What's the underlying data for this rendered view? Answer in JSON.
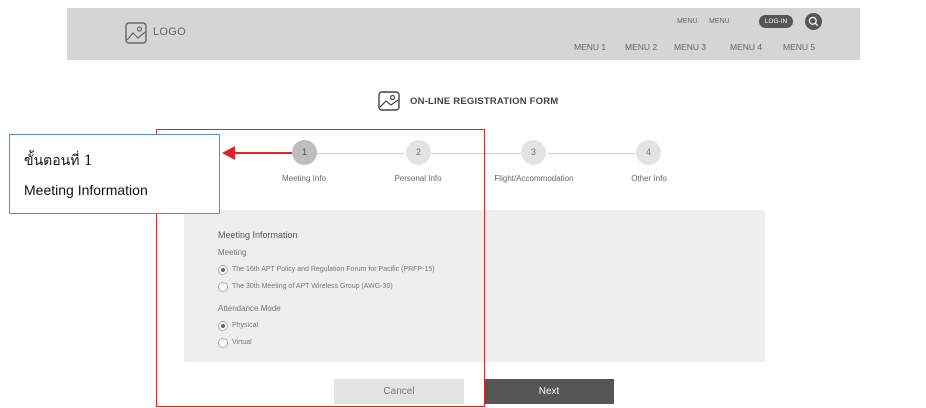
{
  "header": {
    "logo_icon": "image-placeholder-icon",
    "logo_text": "LOGO",
    "top_links": [
      "MENU",
      "MENU"
    ],
    "login_label": "LOG-IN",
    "search_icon": "search-icon",
    "menu": [
      "MENU 1",
      "MENU 2",
      "MENU 3",
      "MENU 4",
      "MENU 5"
    ]
  },
  "form": {
    "title_icon": "image-placeholder-icon",
    "title": "ON-LINE REGISTRATION FORM"
  },
  "steps": [
    {
      "number": "1",
      "label": "Meeting Info",
      "active": true
    },
    {
      "number": "2",
      "label": "Personal Info",
      "active": false
    },
    {
      "number": "3",
      "label": "Flight/Accommodation",
      "active": false
    },
    {
      "number": "4",
      "label": "Other Info",
      "active": false
    }
  ],
  "card": {
    "heading": "Meeting Information",
    "meeting_label": "Meeting",
    "meeting_options": [
      {
        "label": "The 16th APT Policy and Regulation Forum for Pacific (PRFP-15)",
        "selected": true
      },
      {
        "label": "The 30th Meeting of APT Wireless Group (AWG-30)",
        "selected": false
      }
    ],
    "attendance_label": "Attendance Mode",
    "attendance_options": [
      {
        "label": "Physical",
        "selected": true
      },
      {
        "label": "Virtual",
        "selected": false
      }
    ]
  },
  "buttons": {
    "cancel": "Cancel",
    "next": "Next"
  },
  "annotation": {
    "line1": "ขั้นตอนที่ 1",
    "line2": "Meeting Information",
    "color": "#e02424",
    "callout_border": "#5b8fd6"
  }
}
